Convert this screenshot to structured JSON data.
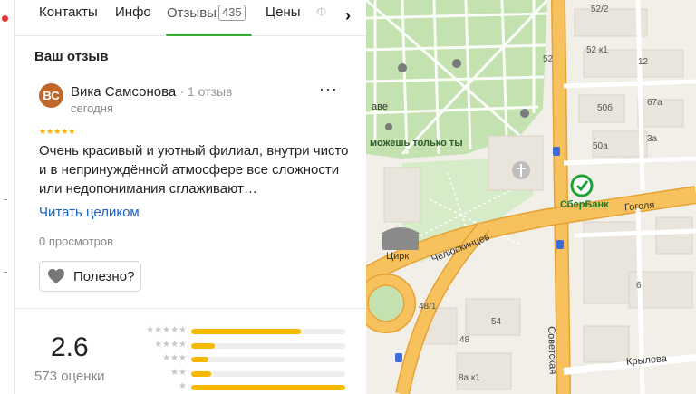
{
  "tabs": [
    {
      "label": "Контакты"
    },
    {
      "label": "Инфо"
    },
    {
      "label": "Отзывы",
      "badge": "435",
      "active": true
    },
    {
      "label": "Цены"
    },
    {
      "label": "Ф"
    }
  ],
  "section_title": "Ваш отзыв",
  "review": {
    "avatar_initials": "ВС",
    "author": "Вика Самсонова",
    "author_meta": "· 1 отзыв",
    "date": "сегодня",
    "rating_stars": 5,
    "text": "Очень красивый и уютный филиал, внутри чисто и в непринуждённой атмосфере все сложности или недопонимания сглаживают…",
    "read_more": "Читать целиком",
    "views": "0 просмотров",
    "useful_label": "Полезно?"
  },
  "rating": {
    "score": "2.6",
    "count_label": "573 оценки",
    "distribution": [
      {
        "stars": 5,
        "fraction": 0.71
      },
      {
        "stars": 4,
        "fraction": 0.15
      },
      {
        "stars": 3,
        "fraction": 0.11
      },
      {
        "stars": 2,
        "fraction": 0.13
      },
      {
        "stars": 1,
        "fraction": 1.0
      }
    ]
  },
  "map": {
    "labels": {
      "circus": "Цирк",
      "sberbank": "СберБанк",
      "gogolya": "Гоголя",
      "chelyuskintsev": "Челюскинцев",
      "sovetskaya": "Советская",
      "krylova": "Крылова",
      "mozhesh": "можешь только ты",
      "ave": "аве"
    },
    "house_numbers": [
      "52/2",
      "52 к1",
      "52",
      "12",
      "50б",
      "67а",
      "50а",
      "3а",
      "48/1",
      "54",
      "48",
      "6",
      "8а к1"
    ],
    "colors": {
      "road_main": "#f7c15e",
      "road_outline": "#e6a233",
      "park": "#bfe0ac",
      "block": "#f3efe6",
      "sber": "#21a038"
    }
  }
}
